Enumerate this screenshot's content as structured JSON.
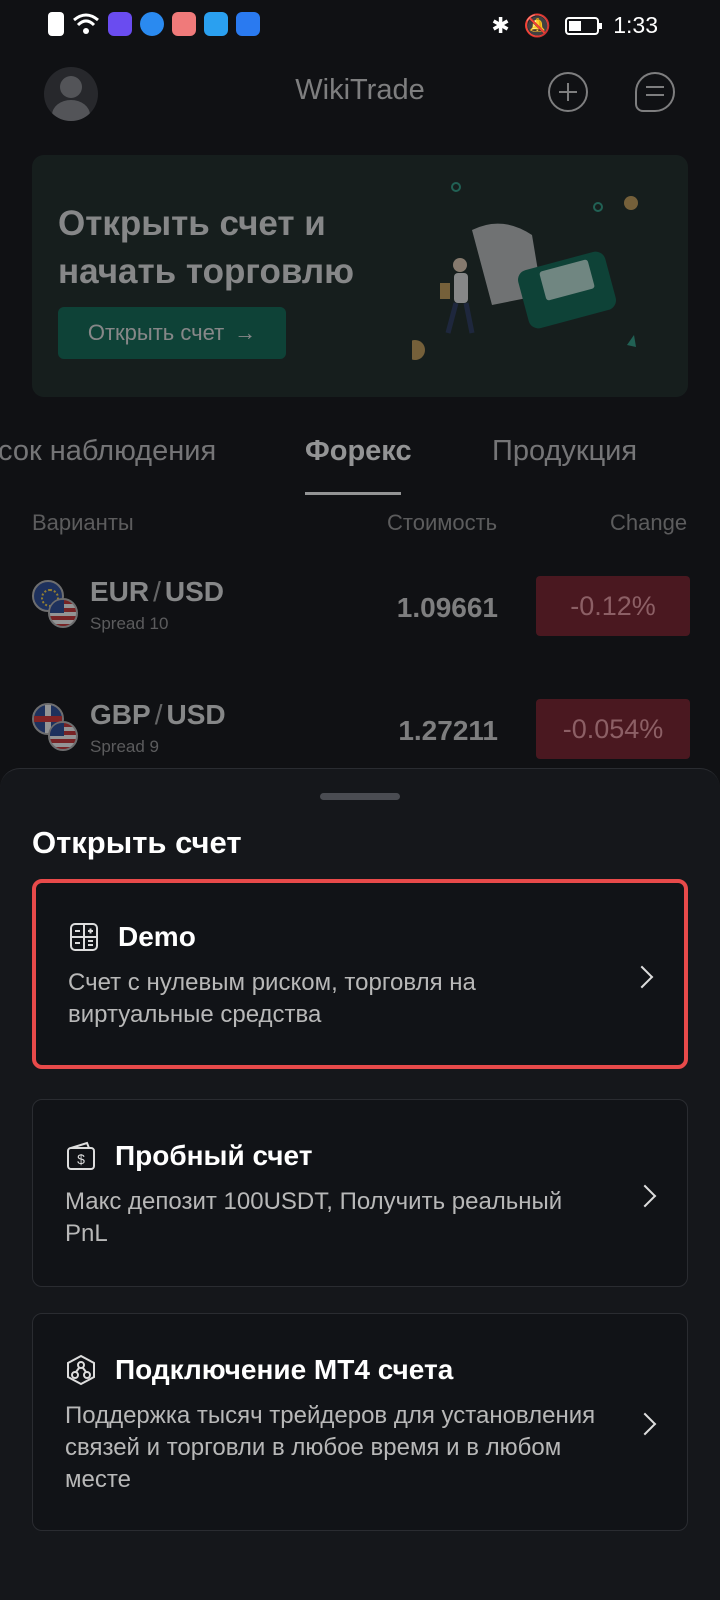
{
  "status_bar": {
    "time": "1:33",
    "left_icons": [
      "alert-icon",
      "wifi-icon",
      "music-app-icon",
      "browser-app-icon",
      "mail-app-icon",
      "search-app-icon",
      "cloud-app-icon"
    ],
    "right_icons": [
      "bluetooth-icon",
      "mute-icon",
      "battery-icon"
    ]
  },
  "header": {
    "title": "WikiTrade"
  },
  "banner": {
    "title": "Открыть счет и начать торговлю",
    "button_label": "Открыть счет",
    "button_arrow": "→"
  },
  "tabs": [
    {
      "label": "сок наблюдения",
      "active": false
    },
    {
      "label": "Форекс",
      "active": true
    },
    {
      "label": "Продукция",
      "active": false
    }
  ],
  "table": {
    "columns": {
      "variants": "Варианты",
      "value": "Стоимость",
      "change": "Change"
    },
    "rows": [
      {
        "base": "EUR",
        "sep": "/",
        "quote": "USD",
        "spread": "Spread 10",
        "price": "1.09661",
        "change": "-0.12%"
      },
      {
        "base": "GBP",
        "sep": "/",
        "quote": "USD",
        "spread": "Spread 9",
        "price": "1.27211",
        "change": "-0.054%"
      }
    ]
  },
  "sheet": {
    "title": "Открыть счет",
    "options": [
      {
        "title": "Demo",
        "description": "Счет с нулевым риском, торговля на виртуальные средства",
        "icon": "calculator-icon",
        "selected": true
      },
      {
        "title": "Пробный счет",
        "description": "Макс депозит 100USDT, Получить реальный PnL",
        "icon": "wallet-dollar-icon",
        "selected": false
      },
      {
        "title": "Подключение MT4 счета",
        "description": "Поддержка тысяч трейдеров для установления связей и торговли в любое время и в любом месте",
        "icon": "network-icon",
        "selected": false
      }
    ]
  },
  "colors": {
    "accent_green": "#0d6b55",
    "negative": "#7a1e2a",
    "highlight": "#e84a4a"
  }
}
